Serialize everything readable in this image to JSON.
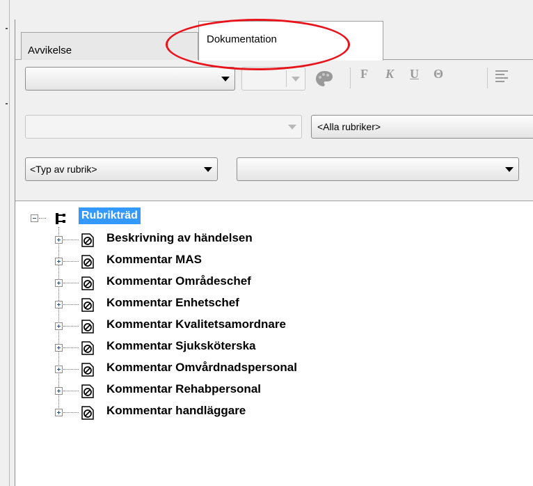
{
  "tabs": [
    {
      "label": "Avvikelse",
      "selected": false
    },
    {
      "label": "Dokumentation",
      "selected": true
    }
  ],
  "format_toolbar": {
    "font_combo_value": "",
    "size_combo_value": "",
    "bold": "F",
    "italic": "K",
    "underline": "U",
    "strikethrough": "Θ"
  },
  "filter_row": {
    "left_combo_value": "",
    "heading_combo_value": "<Alla rubriker>"
  },
  "type_row": {
    "type_combo_value": "<Typ av rubrik>",
    "second_combo_value": ""
  },
  "tree": {
    "root_label": "Rubrikträd",
    "items": [
      "Beskrivning av händelsen",
      "Kommentar MAS",
      "Kommentar Områdeschef",
      "Kommentar Enhetschef",
      "Kommentar Kvalitetsamordnare",
      "Kommentar Sjuksköterska",
      "Kommentar Omvårdnadspersonal",
      "Kommentar Rehabpersonal",
      "Kommentar handläggare"
    ]
  },
  "icons": [
    "palette-icon",
    "align-left-icon",
    "tree-root-icon",
    "document-icon",
    "expand-plus-icon",
    "collapse-minus-icon"
  ],
  "colors": {
    "selection": "#3399ff",
    "annotation_oval": "#e8141b"
  }
}
